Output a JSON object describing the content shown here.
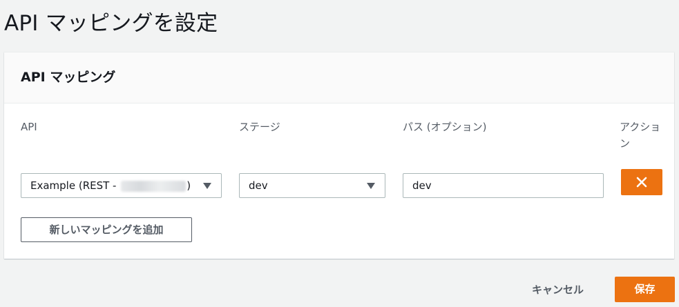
{
  "page": {
    "title": "API マッピングを設定"
  },
  "panel": {
    "title": "API マッピング",
    "columns": {
      "api": "API",
      "stage": "ステージ",
      "path": "パス (オプション)",
      "action": "アクション"
    },
    "row": {
      "api_value": "Example (REST - ",
      "api_value_suffix": ")",
      "stage_value": "dev",
      "path_value": "dev",
      "remove_icon": "close-icon"
    },
    "add_mapping_label": "新しいマッピングを追加"
  },
  "footer": {
    "cancel_label": "キャンセル",
    "save_label": "保存"
  },
  "colors": {
    "accent": "#ec7211",
    "background": "#f2f3f3",
    "border": "#aab7b8",
    "secondary_text": "#545b64"
  }
}
